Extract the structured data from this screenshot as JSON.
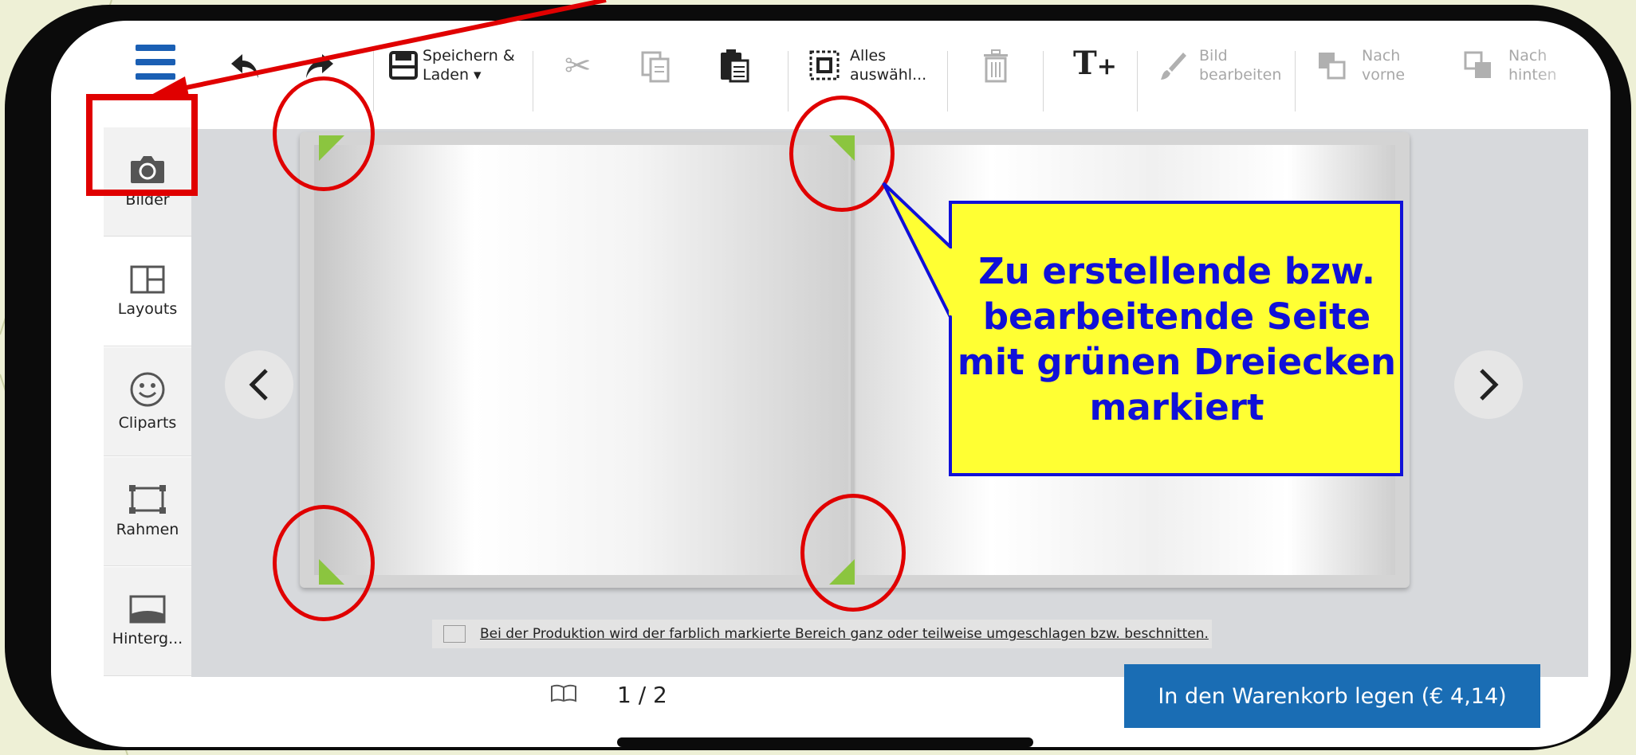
{
  "toolbar": {
    "save_label_1": "Speichern &",
    "save_label_2": "Laden ▾",
    "select_all_1": "Alles",
    "select_all_2": "auswähl...",
    "edit_image_1": "Bild",
    "edit_image_2": "bearbeiten",
    "forward_1": "Nach",
    "forward_2": "vorne",
    "backward_1": "Nach",
    "backward_2": "hinten"
  },
  "sidebar": {
    "items": [
      {
        "label": "Bilder"
      },
      {
        "label": "Layouts"
      },
      {
        "label": "Cliparts"
      },
      {
        "label": "Rahmen"
      },
      {
        "label": "Hinterg..."
      }
    ]
  },
  "annotation": {
    "callout": "Zu erstellende bzw. bearbeitende Seite mit grünen Dreiecken markiert",
    "line1": "Zu erstellende bzw.",
    "line2": "bearbeitende Seite",
    "line3": "mit grünen Dreiecken",
    "line4": "markiert"
  },
  "notice": {
    "text": "Bei der Produktion wird der farblich markierte Bereich ganz oder teilweise umgeschlagen bzw. beschnitten."
  },
  "footer": {
    "page_counter": "1 / 2",
    "cart_button": "In den Warenkorb legen (€ 4,14)"
  },
  "colors": {
    "accent_blue": "#1a6db4",
    "menu_blue": "#1a5fb4",
    "marker_green": "#8bc53f",
    "annotation_red": "#e00000",
    "callout_yellow": "#ffff33",
    "callout_text": "#1010d8"
  }
}
